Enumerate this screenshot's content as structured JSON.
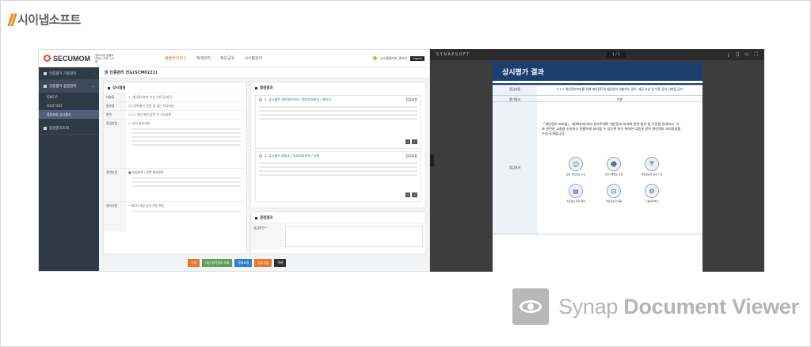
{
  "brand": {
    "logo_text": "시이냅소프트"
  },
  "app": {
    "logo": "SECUMOM",
    "logo_sub": "정보보호 컴플라이언스 관리 시스템",
    "nav": [
      "컴플라이언스",
      "체계관리",
      "정보공유",
      "시스템관리"
    ],
    "nav_active_index": 0,
    "user": "시스템관리자 관리자",
    "logout": "Logout",
    "sidebar": [
      {
        "label": "인증평가 기준관리",
        "active": false
      },
      {
        "label": "인증평가 점검관리",
        "active": true
      }
    ],
    "sidebar_sub": [
      {
        "label": "ISMS-P",
        "active": false
      },
      {
        "label": "ISO27001",
        "active": false
      },
      {
        "label": "정보보호 상시평가",
        "active": true
      }
    ],
    "sidebar_bottom": "점검결과조회",
    "page_title": "원 인증관리 전도(SCM0221)",
    "left_section": "상시점검",
    "left_rows": [
      {
        "k": "대분류",
        "v": "1. 개인정보보호 조치 이유 및 판단"
      },
      {
        "k": "중분류",
        "v": "1.1 정보통신 운용 및 접근 모니터링"
      },
      {
        "k": "항목",
        "v": "1.1.1 개인 처리 항목 이 고지사항"
      },
      {
        "k": "점검방법",
        "v": "1. 조치 처리사항"
      },
      {
        "k": "관련인증",
        "v": "■ 대상항목 / 관련 세부항목"
      },
      {
        "k": "관리사항",
        "v": "• 제3자 제공 동의 여부 확인"
      }
    ],
    "right_section": "점검결과",
    "card1": {
      "title": "1. 상시평가 개인정보처리 / 정보보호본부 / 관리자",
      "status": "점검요청"
    },
    "card2": {
      "title": "2. 상시평가 대외조 / 정보보호본부 / 사원",
      "status": "점검요청"
    },
    "result_section": "점검결과",
    "result_label": "점검의견 *",
    "buttons": [
      {
        "label": "삭제",
        "color": "#e6792a"
      },
      {
        "label": "대상 평가결과 조회",
        "color": "#5aa35a"
      },
      {
        "label": "결재요청",
        "color": "#2f7fd1"
      },
      {
        "label": "임시저장",
        "color": "#e6792a"
      },
      {
        "label": "목록",
        "color": "#333333"
      }
    ]
  },
  "viewer": {
    "brand": "SYNAPSOFT",
    "page_indicator": "1 / 1",
    "doc_title": "상시평가 결과",
    "rows": [
      {
        "k": "점검내용",
        "v": "3.1.2 개인정보보호를 위해 에이전트의 제공받아 개발하는 경우, 제공 사실 및 이용 동의 사항을 공지"
      },
      {
        "k": "평가결과",
        "v": "이행"
      }
    ],
    "row3_key": "점검결과",
    "notice": "「개인정보 보호법」 제30조에 따라 정보주체의 개인정보 처리에 관한 절차 및 기준을 안내하고, 이와 관련한 고충을 신속하고 원활하게 처리할 수 있도록 하기 위하여 다음과 같이 개인정보 처리방침을 수립·공개합니다.",
    "icons": [
      {
        "label": "일반 개인정보 수집",
        "name": "person-icon",
        "glyph": "☺"
      },
      {
        "label": "고유식별정보 수집",
        "name": "id-icon",
        "glyph": "☻"
      },
      {
        "label": "개인정보의 보유 기간",
        "name": "shield-icon",
        "glyph": "⛨"
      },
      {
        "label": "개인정보 처리 위탁",
        "name": "document-icon",
        "glyph": "▤"
      },
      {
        "label": "개인정보의 제공",
        "name": "lock-icon",
        "glyph": "⊡"
      },
      {
        "label": "고충처리부서",
        "name": "gear-icon",
        "glyph": "⚙"
      }
    ]
  },
  "watermark": {
    "light": "Synap ",
    "bold": "Document Viewer"
  }
}
